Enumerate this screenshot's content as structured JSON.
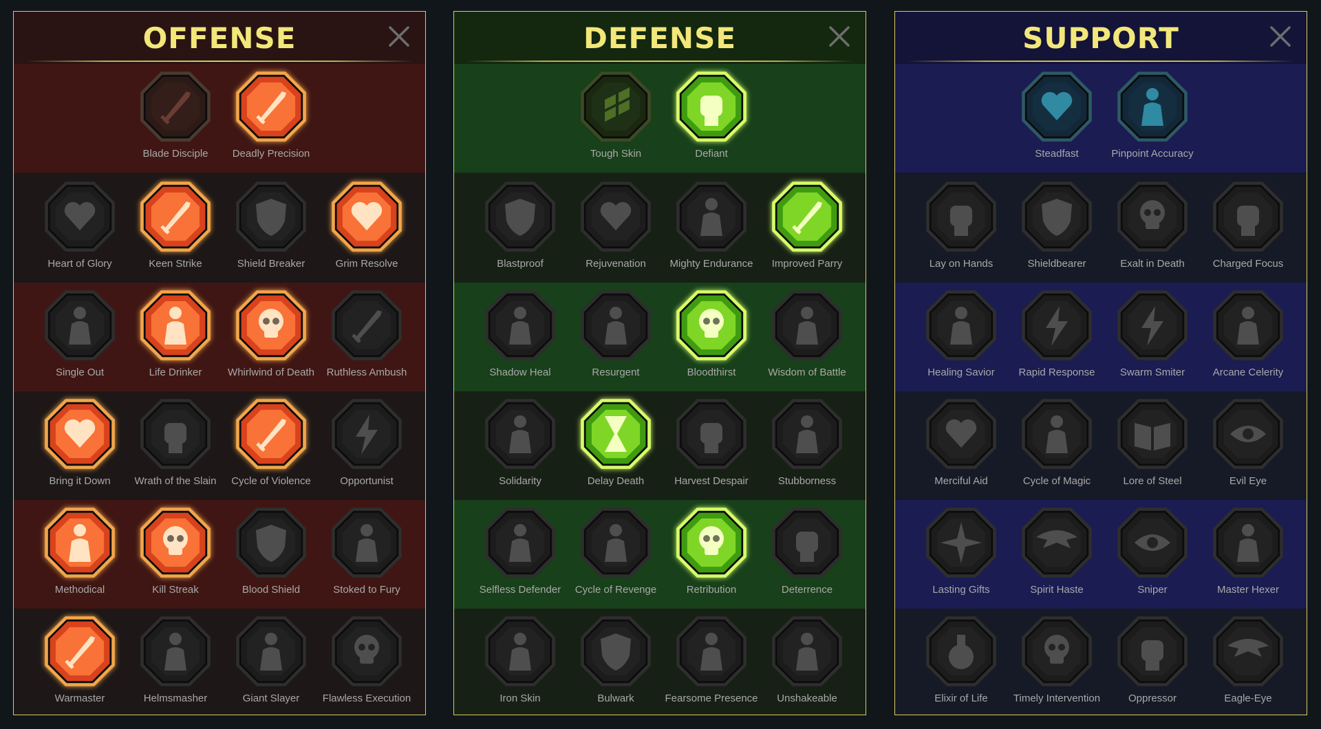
{
  "panels": [
    {
      "id": "offense",
      "title": "OFFENSE",
      "close_icon": "close-icon",
      "rows": [
        [
          {
            "label": "Blade Disciple",
            "icon": "crossed-swords-icon",
            "state": "dim"
          },
          {
            "label": "Deadly Precision",
            "icon": "dagger-burst-icon",
            "state": "active"
          }
        ],
        [
          {
            "label": "Heart of Glory",
            "icon": "horned-figure-heart-icon",
            "state": "inactive"
          },
          {
            "label": "Keen Strike",
            "icon": "spear-strike-icon",
            "state": "active"
          },
          {
            "label": "Shield Breaker",
            "icon": "broken-shield-icon",
            "state": "inactive"
          },
          {
            "label": "Grim Resolve",
            "icon": "spiked-heart-icon",
            "state": "active"
          }
        ],
        [
          {
            "label": "Single Out",
            "icon": "pierced-figure-icon",
            "state": "inactive"
          },
          {
            "label": "Life Drinker",
            "icon": "fangs-icon",
            "state": "active"
          },
          {
            "label": "Whirlwind of Death",
            "icon": "skull-whirl-icon",
            "state": "active"
          },
          {
            "label": "Ruthless Ambush",
            "icon": "hooded-blade-icon",
            "state": "inactive"
          }
        ],
        [
          {
            "label": "Bring it Down",
            "icon": "sword-heart-icon",
            "state": "active"
          },
          {
            "label": "Wrath of the Slain",
            "icon": "fist-hammer-icon",
            "state": "inactive"
          },
          {
            "label": "Cycle of Violence",
            "icon": "axe-icon",
            "state": "active"
          },
          {
            "label": "Opportunist",
            "icon": "chain-lightning-icon",
            "state": "inactive"
          }
        ],
        [
          {
            "label": "Methodical",
            "icon": "arrows-target-icon",
            "state": "active"
          },
          {
            "label": "Kill Streak",
            "icon": "triple-skull-icon",
            "state": "active"
          },
          {
            "label": "Blood Shield",
            "icon": "sword-shield-icon",
            "state": "inactive"
          },
          {
            "label": "Stoked to Fury",
            "icon": "raging-figure-icon",
            "state": "inactive"
          }
        ],
        [
          {
            "label": "Warmaster",
            "icon": "sword-sparkle-icon",
            "state": "active"
          },
          {
            "label": "Helmsmasher",
            "icon": "helmet-icon",
            "state": "inactive"
          },
          {
            "label": "Giant Slayer",
            "icon": "giant-icon",
            "state": "inactive"
          },
          {
            "label": "Flawless Execution",
            "icon": "skull-sword-icon",
            "state": "inactive"
          }
        ]
      ]
    },
    {
      "id": "defense",
      "title": "DEFENSE",
      "close_icon": "close-icon",
      "rows": [
        [
          {
            "label": "Tough Skin",
            "icon": "scales-icon",
            "state": "dim"
          },
          {
            "label": "Defiant",
            "icon": "raised-fist-icon",
            "state": "active"
          }
        ],
        [
          {
            "label": "Blastproof",
            "icon": "shield-icon",
            "state": "inactive"
          },
          {
            "label": "Rejuvenation",
            "icon": "anatomical-heart-icon",
            "state": "inactive"
          },
          {
            "label": "Mighty Endurance",
            "icon": "armored-figure-icon",
            "state": "inactive"
          },
          {
            "label": "Improved Parry",
            "icon": "crossed-blades-icon",
            "state": "active"
          }
        ],
        [
          {
            "label": "Shadow Heal",
            "icon": "shadow-figures-icon",
            "state": "inactive"
          },
          {
            "label": "Resurgent",
            "icon": "knight-icon",
            "state": "inactive"
          },
          {
            "label": "Bloodthirst",
            "icon": "skull-heart-icon",
            "state": "active"
          },
          {
            "label": "Wisdom of Battle",
            "icon": "monk-head-icon",
            "state": "inactive"
          }
        ],
        [
          {
            "label": "Solidarity",
            "icon": "group-icon",
            "state": "inactive"
          },
          {
            "label": "Delay Death",
            "icon": "hourglass-icon",
            "state": "active"
          },
          {
            "label": "Harvest Despair",
            "icon": "open-hand-icon",
            "state": "inactive"
          },
          {
            "label": "Stubborness",
            "icon": "bull-icon",
            "state": "inactive"
          }
        ],
        [
          {
            "label": "Selfless Defender",
            "icon": "running-figure-icon",
            "state": "inactive"
          },
          {
            "label": "Cycle of Revenge",
            "icon": "blood-drops-icon",
            "state": "inactive"
          },
          {
            "label": "Retribution",
            "icon": "sun-skull-icon",
            "state": "active"
          },
          {
            "label": "Deterrence",
            "icon": "reaching-hand-icon",
            "state": "inactive"
          }
        ],
        [
          {
            "label": "Iron Skin",
            "icon": "spiked-figure-icon",
            "state": "inactive"
          },
          {
            "label": "Bulwark",
            "icon": "winged-shield-icon",
            "state": "inactive"
          },
          {
            "label": "Fearsome Presence",
            "icon": "bearded-warrior-icon",
            "state": "inactive"
          },
          {
            "label": "Unshakeable",
            "icon": "strongman-icon",
            "state": "inactive"
          }
        ]
      ]
    },
    {
      "id": "support",
      "title": "SUPPORT",
      "close_icon": "close-icon",
      "rows": [
        [
          {
            "label": "Steadfast",
            "icon": "heart-plus-icon",
            "state": "dim"
          },
          {
            "label": "Pinpoint Accuracy",
            "icon": "swirl-target-icon",
            "state": "dim"
          }
        ],
        [
          {
            "label": "Lay on Hands",
            "icon": "praying-hands-icon",
            "state": "inactive"
          },
          {
            "label": "Shieldbearer",
            "icon": "shield-aura-icon",
            "state": "inactive"
          },
          {
            "label": "Exalt in Death",
            "icon": "flaming-skull-icon",
            "state": "inactive"
          },
          {
            "label": "Charged Focus",
            "icon": "speeding-hand-icon",
            "state": "inactive"
          }
        ],
        [
          {
            "label": "Healing Savior",
            "icon": "healer-icon",
            "state": "inactive"
          },
          {
            "label": "Rapid Response",
            "icon": "lightning-icon",
            "state": "inactive"
          },
          {
            "label": "Swarm Smiter",
            "icon": "zigzag-icon",
            "state": "inactive"
          },
          {
            "label": "Arcane Celerity",
            "icon": "fast-figure-icon",
            "state": "inactive"
          }
        ],
        [
          {
            "label": "Merciful Aid",
            "icon": "chained-heart-icon",
            "state": "inactive"
          },
          {
            "label": "Cycle of Magic",
            "icon": "comet-icon",
            "state": "inactive"
          },
          {
            "label": "Lore of Steel",
            "icon": "open-book-icon",
            "state": "inactive"
          },
          {
            "label": "Evil Eye",
            "icon": "rays-eye-icon",
            "state": "inactive"
          }
        ],
        [
          {
            "label": "Lasting Gifts",
            "icon": "compass-star-icon",
            "state": "inactive"
          },
          {
            "label": "Spirit Haste",
            "icon": "winged-boot-icon",
            "state": "inactive"
          },
          {
            "label": "Sniper",
            "icon": "eye-icon",
            "state": "inactive"
          },
          {
            "label": "Master Hexer",
            "icon": "voodoo-doll-icon",
            "state": "inactive"
          }
        ],
        [
          {
            "label": "Elixir of Life",
            "icon": "potion-icon",
            "state": "inactive"
          },
          {
            "label": "Timely Intervention",
            "icon": "skull-icon",
            "state": "inactive"
          },
          {
            "label": "Oppressor",
            "icon": "crushing-fist-icon",
            "state": "inactive"
          },
          {
            "label": "Eagle-Eye",
            "icon": "eagle-icon",
            "state": "inactive"
          }
        ]
      ]
    }
  ],
  "colors": {
    "offense_active": "#f06030",
    "defense_active": "#b6f030",
    "support_dim": "#2a8aa0",
    "inactive": "#333333",
    "title": "#f2e77a",
    "panel_border": "#d9cc62"
  }
}
